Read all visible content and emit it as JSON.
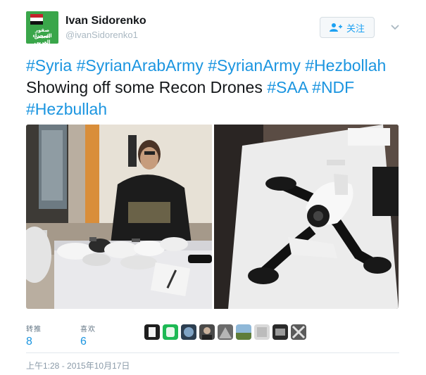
{
  "header": {
    "display_name": "Ivan Sidorenko",
    "handle": "@ivanSidorenko1",
    "follow_label": "关注",
    "avatar_text_line1": "صقور الصحراء",
    "avatar_text_line2": "الجيش العربي"
  },
  "tweet": {
    "tokens": [
      {
        "text": "#Syria",
        "hashtag": true
      },
      {
        "text": " ",
        "hashtag": false
      },
      {
        "text": "#SyrianArabArmy",
        "hashtag": true
      },
      {
        "text": " ",
        "hashtag": false
      },
      {
        "text": "#SyrianArmy",
        "hashtag": true
      },
      {
        "text": " ",
        "hashtag": false
      },
      {
        "text": "#Hezbollah",
        "hashtag": true
      },
      {
        "text": " Showing off some Recon Drones ",
        "hashtag": false
      },
      {
        "text": "#SAA",
        "hashtag": true
      },
      {
        "text": " ",
        "hashtag": false
      },
      {
        "text": "#NDF",
        "hashtag": true
      },
      {
        "text": " ",
        "hashtag": false
      },
      {
        "text": "#Hezbullah",
        "hashtag": true
      }
    ]
  },
  "stats": {
    "retweets_label": "转推",
    "retweets_value": "8",
    "likes_label": "喜欢",
    "likes_value": "6"
  },
  "timestamp": "上午1:28 - 2015年10月17日",
  "colors": {
    "hashtag": "#1b95e0",
    "text": "#14171a",
    "muted": "#657786"
  }
}
